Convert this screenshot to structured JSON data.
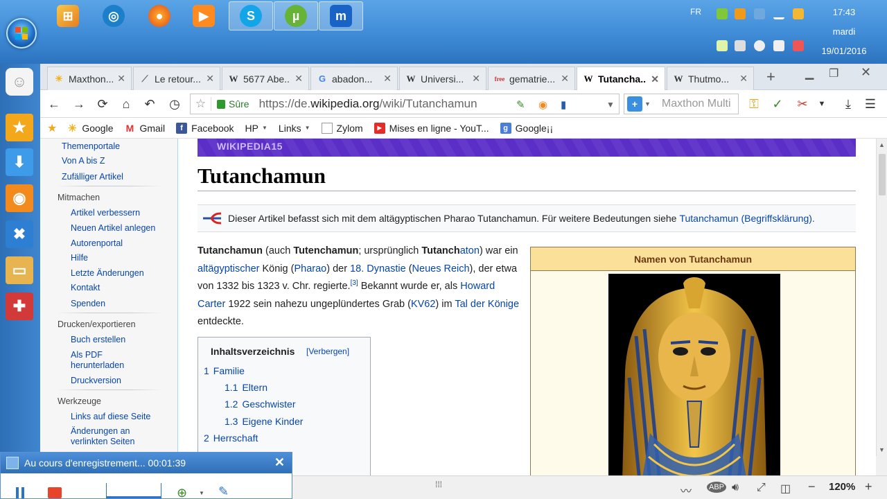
{
  "system": {
    "language": "FR",
    "time": "17:43",
    "weekday": "mardi",
    "date": "19/01/2016"
  },
  "tabs": [
    {
      "title": "Maxthon..."
    },
    {
      "title": "Le retour..."
    },
    {
      "title": "5677 Abe..."
    },
    {
      "title": "abadon..."
    },
    {
      "title": "Universi..."
    },
    {
      "title": "gematrie..."
    },
    {
      "title": "Tutancha...",
      "active": true
    },
    {
      "title": "Thutmo..."
    }
  ],
  "address": {
    "secure_label": "Sûre",
    "url_prefix": "https://de.",
    "url_domain": "wikipedia.org",
    "url_path": "/wiki/Tutanchamun"
  },
  "search": {
    "placeholder": "Maxthon Multi"
  },
  "bookmarks": [
    {
      "label": "Google"
    },
    {
      "label": "Gmail"
    },
    {
      "label": "Facebook"
    },
    {
      "label": "HP"
    },
    {
      "label": "Links"
    },
    {
      "label": "Zylom"
    },
    {
      "label": "Mises en ligne - YouT..."
    },
    {
      "label": "Google¡¡"
    }
  ],
  "sidebar": {
    "top_links": [
      "Themenportale",
      "Von A bis Z",
      "Zufälliger Artikel"
    ],
    "mitmachen_heading": "Mitmachen",
    "mitmachen_links": [
      "Artikel verbessern",
      "Neuen Artikel anlegen",
      "Autorenportal",
      "Hilfe",
      "Letzte Änderungen",
      "Kontakt",
      "Spenden"
    ],
    "drucken_heading": "Drucken/exportieren",
    "drucken_links": [
      "Buch erstellen",
      "Als PDF",
      "herunterladen",
      "Druckversion"
    ],
    "werkzeuge_heading": "Werkzeuge",
    "werkzeuge_links": [
      "Links auf diese Seite",
      "Änderungen an",
      "verlinkten Seiten"
    ]
  },
  "article": {
    "banner": "WIKIPEDIA15",
    "title": "Tutanchamun",
    "hatnote_text": "Dieser Artikel befasst sich mit dem altägyptischen Pharao Tutanchamun. Für weitere Bedeutungen siehe ",
    "hatnote_link": "Tutanchamun (Begriffsklärung)",
    "hatnote_end": ".",
    "intro": {
      "b1": "Tutanchamun",
      "t1": " (auch ",
      "b2": "Tutenchamun",
      "t2": "; ursprünglich ",
      "b3": "Tutanch",
      "l0": "aton",
      "t3": ") war ein ",
      "l1": "altägyptischer",
      "t4": " König (",
      "l2": "Pharao",
      "t5": ") der ",
      "l3": "18. Dynastie",
      "t6": " (",
      "l4": "Neues Reich",
      "t7": "), der etwa von 1332 bis 1323 v. Chr. regierte.",
      "ref": "[3]",
      "t8": " Bekannt wurde er, als ",
      "l5": "Howard Carter",
      "t9": " 1922 sein nahezu ungeplündertes Grab (",
      "l6": "KV62",
      "t10": ") im ",
      "l7": "Tal der Könige",
      "t11": " entdeckte."
    },
    "toc": {
      "title": "Inhaltsverzeichnis",
      "hide": "[Verbergen]",
      "items": [
        {
          "num": "1",
          "label": "Familie"
        },
        {
          "num": "1.1",
          "label": "Eltern"
        },
        {
          "num": "1.2",
          "label": "Geschwister"
        },
        {
          "num": "1.3",
          "label": "Eigene Kinder"
        },
        {
          "num": "2",
          "label": "Herrschaft"
        }
      ]
    },
    "infobox_title": "Namen von Tutanchamun"
  },
  "status": {
    "zoom": "120%"
  },
  "recorder": {
    "label": "Au cours d'enregistrement... 00:01:39"
  }
}
